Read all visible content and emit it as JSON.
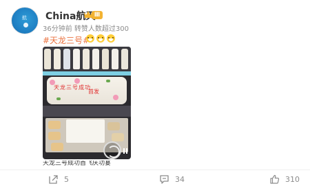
{
  "user": {
    "name": "China航天",
    "vip_level": "Ⅲ",
    "meta": "36分钟前 转赞人数超过300"
  },
  "post": {
    "topic": "#天龙三号#",
    "emojis": [
      "laughing-face",
      "laughing-face",
      "laughing-face"
    ],
    "media": {
      "cake_text": "天龙三号成功",
      "cake_text_2": "首发",
      "caption": "天龙三号成功首飞庆功宴"
    }
  },
  "actions": {
    "share_count": "5",
    "comment_count": "34",
    "like_count": "310"
  },
  "colors": {
    "accent": "#eb7340",
    "meta_gray": "#8c8c8c",
    "vip_gold": "#f3b332"
  }
}
